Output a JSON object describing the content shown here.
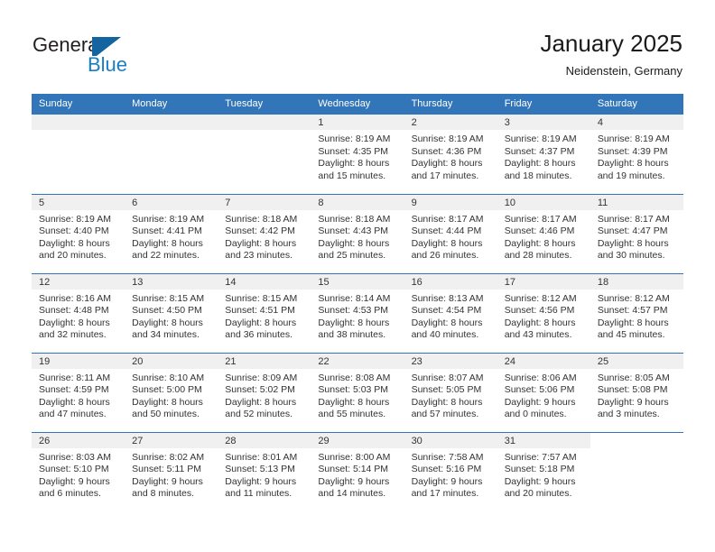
{
  "brand": {
    "name_top": "General",
    "name_bottom": "Blue",
    "mark_icon": "triangle-flag-icon",
    "color_dark": "#231f20",
    "color_blue": "#1a7ec4"
  },
  "header": {
    "title": "January 2025",
    "subtitle": "Neidenstein, Germany"
  },
  "theme": {
    "header_bar": "#3275b8",
    "daynum_band": "#f0f0f0",
    "text": "#333333",
    "row_rule": "#3275b8"
  },
  "calendar": {
    "weekdays": [
      "Sunday",
      "Monday",
      "Tuesday",
      "Wednesday",
      "Thursday",
      "Friday",
      "Saturday"
    ],
    "labels": {
      "sunrise": "Sunrise:",
      "sunset": "Sunset:",
      "daylight": "Daylight:"
    },
    "weeks": [
      [
        {
          "day": "",
          "empty": true
        },
        {
          "day": "",
          "empty": true
        },
        {
          "day": "",
          "empty": true
        },
        {
          "day": "1",
          "sunrise": "Sunrise: 8:19 AM",
          "sunset": "Sunset: 4:35 PM",
          "daylight_1": "Daylight: 8 hours",
          "daylight_2": "and 15 minutes."
        },
        {
          "day": "2",
          "sunrise": "Sunrise: 8:19 AM",
          "sunset": "Sunset: 4:36 PM",
          "daylight_1": "Daylight: 8 hours",
          "daylight_2": "and 17 minutes."
        },
        {
          "day": "3",
          "sunrise": "Sunrise: 8:19 AM",
          "sunset": "Sunset: 4:37 PM",
          "daylight_1": "Daylight: 8 hours",
          "daylight_2": "and 18 minutes."
        },
        {
          "day": "4",
          "sunrise": "Sunrise: 8:19 AM",
          "sunset": "Sunset: 4:39 PM",
          "daylight_1": "Daylight: 8 hours",
          "daylight_2": "and 19 minutes."
        }
      ],
      [
        {
          "day": "5",
          "sunrise": "Sunrise: 8:19 AM",
          "sunset": "Sunset: 4:40 PM",
          "daylight_1": "Daylight: 8 hours",
          "daylight_2": "and 20 minutes."
        },
        {
          "day": "6",
          "sunrise": "Sunrise: 8:19 AM",
          "sunset": "Sunset: 4:41 PM",
          "daylight_1": "Daylight: 8 hours",
          "daylight_2": "and 22 minutes."
        },
        {
          "day": "7",
          "sunrise": "Sunrise: 8:18 AM",
          "sunset": "Sunset: 4:42 PM",
          "daylight_1": "Daylight: 8 hours",
          "daylight_2": "and 23 minutes."
        },
        {
          "day": "8",
          "sunrise": "Sunrise: 8:18 AM",
          "sunset": "Sunset: 4:43 PM",
          "daylight_1": "Daylight: 8 hours",
          "daylight_2": "and 25 minutes."
        },
        {
          "day": "9",
          "sunrise": "Sunrise: 8:17 AM",
          "sunset": "Sunset: 4:44 PM",
          "daylight_1": "Daylight: 8 hours",
          "daylight_2": "and 26 minutes."
        },
        {
          "day": "10",
          "sunrise": "Sunrise: 8:17 AM",
          "sunset": "Sunset: 4:46 PM",
          "daylight_1": "Daylight: 8 hours",
          "daylight_2": "and 28 minutes."
        },
        {
          "day": "11",
          "sunrise": "Sunrise: 8:17 AM",
          "sunset": "Sunset: 4:47 PM",
          "daylight_1": "Daylight: 8 hours",
          "daylight_2": "and 30 minutes."
        }
      ],
      [
        {
          "day": "12",
          "sunrise": "Sunrise: 8:16 AM",
          "sunset": "Sunset: 4:48 PM",
          "daylight_1": "Daylight: 8 hours",
          "daylight_2": "and 32 minutes."
        },
        {
          "day": "13",
          "sunrise": "Sunrise: 8:15 AM",
          "sunset": "Sunset: 4:50 PM",
          "daylight_1": "Daylight: 8 hours",
          "daylight_2": "and 34 minutes."
        },
        {
          "day": "14",
          "sunrise": "Sunrise: 8:15 AM",
          "sunset": "Sunset: 4:51 PM",
          "daylight_1": "Daylight: 8 hours",
          "daylight_2": "and 36 minutes."
        },
        {
          "day": "15",
          "sunrise": "Sunrise: 8:14 AM",
          "sunset": "Sunset: 4:53 PM",
          "daylight_1": "Daylight: 8 hours",
          "daylight_2": "and 38 minutes."
        },
        {
          "day": "16",
          "sunrise": "Sunrise: 8:13 AM",
          "sunset": "Sunset: 4:54 PM",
          "daylight_1": "Daylight: 8 hours",
          "daylight_2": "and 40 minutes."
        },
        {
          "day": "17",
          "sunrise": "Sunrise: 8:12 AM",
          "sunset": "Sunset: 4:56 PM",
          "daylight_1": "Daylight: 8 hours",
          "daylight_2": "and 43 minutes."
        },
        {
          "day": "18",
          "sunrise": "Sunrise: 8:12 AM",
          "sunset": "Sunset: 4:57 PM",
          "daylight_1": "Daylight: 8 hours",
          "daylight_2": "and 45 minutes."
        }
      ],
      [
        {
          "day": "19",
          "sunrise": "Sunrise: 8:11 AM",
          "sunset": "Sunset: 4:59 PM",
          "daylight_1": "Daylight: 8 hours",
          "daylight_2": "and 47 minutes."
        },
        {
          "day": "20",
          "sunrise": "Sunrise: 8:10 AM",
          "sunset": "Sunset: 5:00 PM",
          "daylight_1": "Daylight: 8 hours",
          "daylight_2": "and 50 minutes."
        },
        {
          "day": "21",
          "sunrise": "Sunrise: 8:09 AM",
          "sunset": "Sunset: 5:02 PM",
          "daylight_1": "Daylight: 8 hours",
          "daylight_2": "and 52 minutes."
        },
        {
          "day": "22",
          "sunrise": "Sunrise: 8:08 AM",
          "sunset": "Sunset: 5:03 PM",
          "daylight_1": "Daylight: 8 hours",
          "daylight_2": "and 55 minutes."
        },
        {
          "day": "23",
          "sunrise": "Sunrise: 8:07 AM",
          "sunset": "Sunset: 5:05 PM",
          "daylight_1": "Daylight: 8 hours",
          "daylight_2": "and 57 minutes."
        },
        {
          "day": "24",
          "sunrise": "Sunrise: 8:06 AM",
          "sunset": "Sunset: 5:06 PM",
          "daylight_1": "Daylight: 9 hours",
          "daylight_2": "and 0 minutes."
        },
        {
          "day": "25",
          "sunrise": "Sunrise: 8:05 AM",
          "sunset": "Sunset: 5:08 PM",
          "daylight_1": "Daylight: 9 hours",
          "daylight_2": "and 3 minutes."
        }
      ],
      [
        {
          "day": "26",
          "sunrise": "Sunrise: 8:03 AM",
          "sunset": "Sunset: 5:10 PM",
          "daylight_1": "Daylight: 9 hours",
          "daylight_2": "and 6 minutes."
        },
        {
          "day": "27",
          "sunrise": "Sunrise: 8:02 AM",
          "sunset": "Sunset: 5:11 PM",
          "daylight_1": "Daylight: 9 hours",
          "daylight_2": "and 8 minutes."
        },
        {
          "day": "28",
          "sunrise": "Sunrise: 8:01 AM",
          "sunset": "Sunset: 5:13 PM",
          "daylight_1": "Daylight: 9 hours",
          "daylight_2": "and 11 minutes."
        },
        {
          "day": "29",
          "sunrise": "Sunrise: 8:00 AM",
          "sunset": "Sunset: 5:14 PM",
          "daylight_1": "Daylight: 9 hours",
          "daylight_2": "and 14 minutes."
        },
        {
          "day": "30",
          "sunrise": "Sunrise: 7:58 AM",
          "sunset": "Sunset: 5:16 PM",
          "daylight_1": "Daylight: 9 hours",
          "daylight_2": "and 17 minutes."
        },
        {
          "day": "31",
          "sunrise": "Sunrise: 7:57 AM",
          "sunset": "Sunset: 5:18 PM",
          "daylight_1": "Daylight: 9 hours",
          "daylight_2": "and 20 minutes."
        },
        {
          "day": "",
          "empty": true,
          "blank": true
        }
      ]
    ]
  }
}
